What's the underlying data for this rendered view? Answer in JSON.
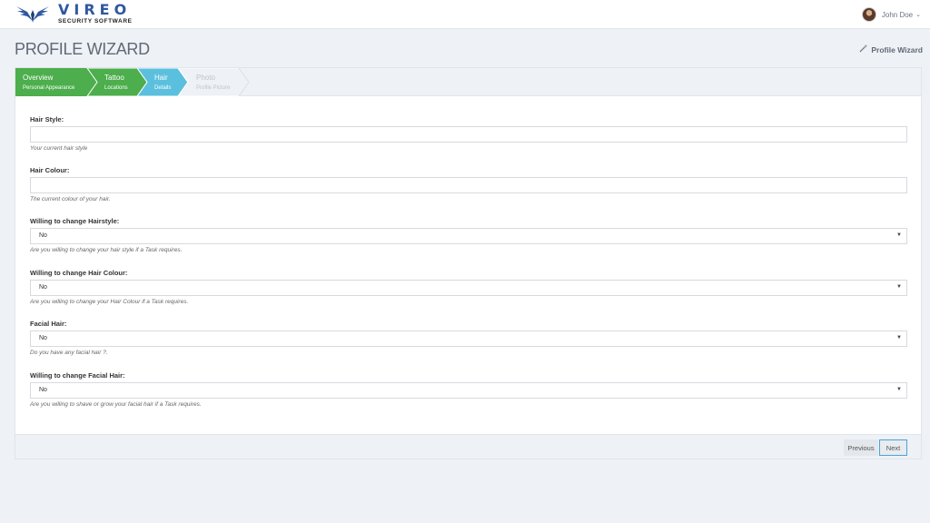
{
  "header": {
    "logo_main": "VIREO",
    "logo_sub": "SECURITY SOFTWARE",
    "user_name": "John Doe",
    "user_caret": "⌄"
  },
  "page": {
    "title": "PROFILE WIZARD",
    "crumb_icon": "magic-wand-icon",
    "crumb": "Profile Wizard"
  },
  "steps": [
    {
      "title": "Overview",
      "subtitle": "Personal Appearance",
      "state": "done",
      "color": "#4cae4c"
    },
    {
      "title": "Tattoo",
      "subtitle": "Locations",
      "state": "done",
      "color": "#4cae4c"
    },
    {
      "title": "Hair",
      "subtitle": "Details",
      "state": "active",
      "color": "#5bc0de"
    },
    {
      "title": "Photo",
      "subtitle": "Profile Picture",
      "state": "pending",
      "color": "#eef1f5"
    }
  ],
  "form": {
    "hair_style": {
      "label": "Hair Style:",
      "value": "",
      "help": "Your current hair style"
    },
    "hair_colour": {
      "label": "Hair Colour:",
      "value": "",
      "help": "The current colour of your hair."
    },
    "change_hairstyle": {
      "label": "Willing to change Hairstyle:",
      "value": "No",
      "help": "Are you willing to change your hair style if a Task requires."
    },
    "change_hair_colour": {
      "label": "Willing to change Hair Colour:",
      "value": "No",
      "help": "Are you willing to change your Hair Colour if a Task requires."
    },
    "facial_hair": {
      "label": "Facial Hair:",
      "value": "No",
      "help": "Do you have any facial hair ?."
    },
    "change_facial_hair": {
      "label": "Willing to change Facial Hair:",
      "value": "No",
      "help": "Are you willing to shave or grow your facial hair if a Task requires."
    },
    "select_arrow": "▼"
  },
  "buttons": {
    "previous": "Previous",
    "next": "Next"
  },
  "colors": {
    "brand": "#2f58a0",
    "step_done": "#4cae4c",
    "step_active": "#5bc0de",
    "next_border": "#4aa3d8"
  }
}
